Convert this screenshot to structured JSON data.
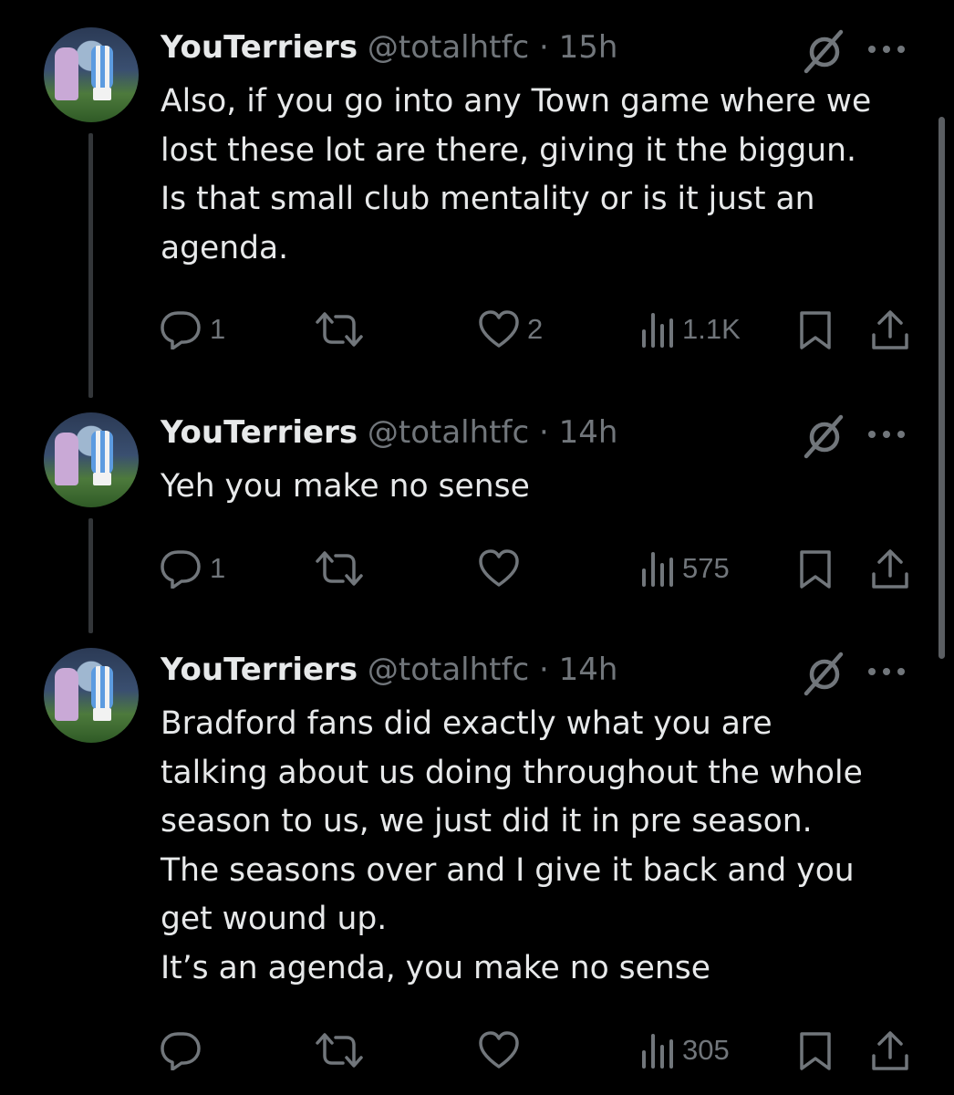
{
  "tweets": [
    {
      "name": "YouTerriers",
      "handle": "@totalhtfc",
      "sep": " · ",
      "time": "15h",
      "text": "Also, if you go into any Town game where we\nlost these lot are there, giving it the biggun.\nIs that small club mentality or is it just an\nagenda.",
      "replies": "1",
      "reposts": "",
      "likes": "2",
      "views": "1.1K"
    },
    {
      "name": "YouTerriers",
      "handle": "@totalhtfc",
      "sep": " · ",
      "time": "14h",
      "text": "Yeh you make no sense",
      "replies": "1",
      "reposts": "",
      "likes": "",
      "views": "575"
    },
    {
      "name": "YouTerriers",
      "handle": "@totalhtfc",
      "sep": " · ",
      "time": "14h",
      "text": "Bradford fans did exactly what you are\ntalking about us doing throughout the whole\nseason to us, we just did it in pre season.\nThe seasons over and I give it back and you\nget wound up.\nIt’s an agenda, you make no sense",
      "replies": "",
      "reposts": "",
      "likes": "",
      "views": "305"
    }
  ],
  "icons": {
    "reply": "reply-icon",
    "repost": "repost-icon",
    "like": "heart-icon",
    "views": "views-icon",
    "bookmark": "bookmark-icon",
    "share": "share-icon",
    "grok": "grok-icon",
    "more": "more-icon"
  },
  "colors": {
    "background": "#000000",
    "text": "#e7e9ea",
    "secondary": "#71767b",
    "thread_line": "#333639"
  }
}
